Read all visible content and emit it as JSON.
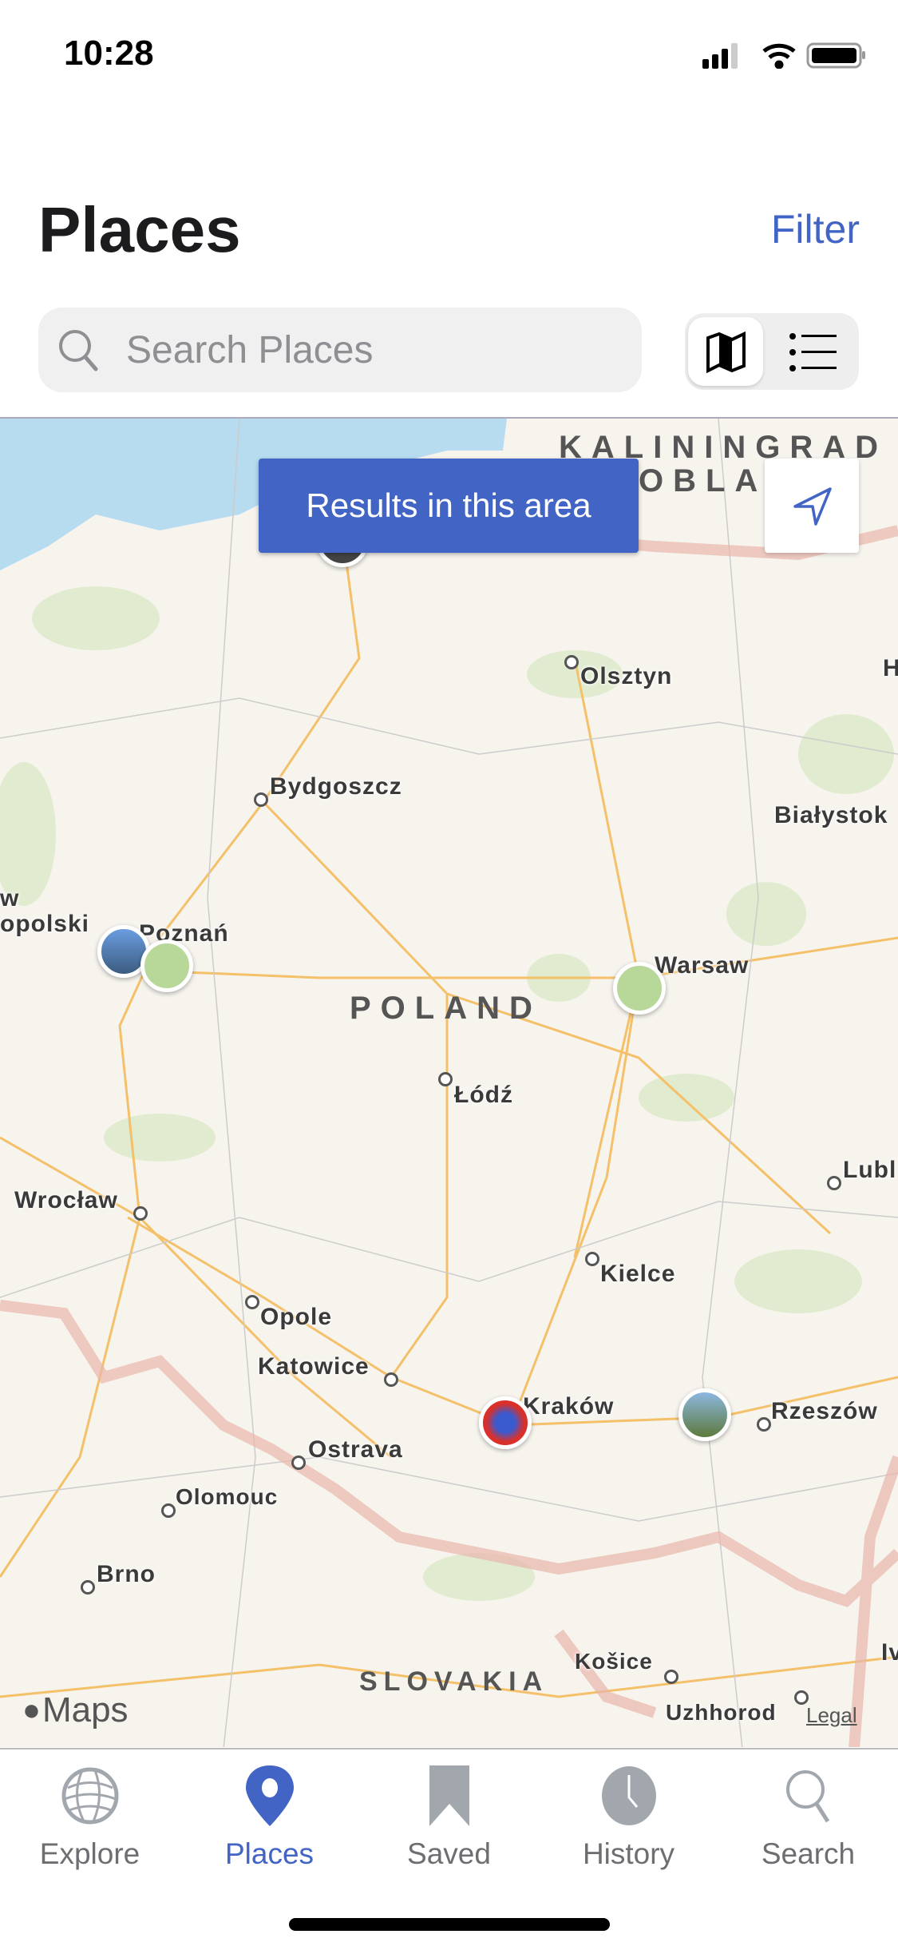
{
  "status": {
    "time": "10:28"
  },
  "header": {
    "title": "Places",
    "filter_label": "Filter"
  },
  "search": {
    "placeholder": "Search Places"
  },
  "view_toggle": {
    "selected": "map",
    "options": [
      "map",
      "list"
    ]
  },
  "map": {
    "results_button": "Results in this area",
    "attribution": "Maps",
    "legal": "Legal",
    "countries": [
      "KALININGRAD",
      "OBLAST",
      "POLAND",
      "SLOVAKIA"
    ],
    "cities": [
      "Olsztyn",
      "Bydgoszcz",
      "Białystok",
      "Poznań",
      "Warsaw",
      "Łódź",
      "Lubl",
      "Wrocław",
      "Kielce",
      "Opole",
      "Katowice",
      "Kraków",
      "Rzeszów",
      "Ostrava",
      "Olomouc",
      "Brno",
      "Košice",
      "Uzhhorod",
      "H",
      "Iv",
      "w",
      "opolski"
    ]
  },
  "tabs": [
    {
      "label": "Explore",
      "icon": "globe-icon"
    },
    {
      "label": "Places",
      "icon": "map-pin-icon",
      "active": true
    },
    {
      "label": "Saved",
      "icon": "bookmark-icon"
    },
    {
      "label": "History",
      "icon": "clock-icon"
    },
    {
      "label": "Search",
      "icon": "search-icon"
    }
  ],
  "colors": {
    "accent": "#4264c4",
    "inactive": "#a2a7ae"
  }
}
